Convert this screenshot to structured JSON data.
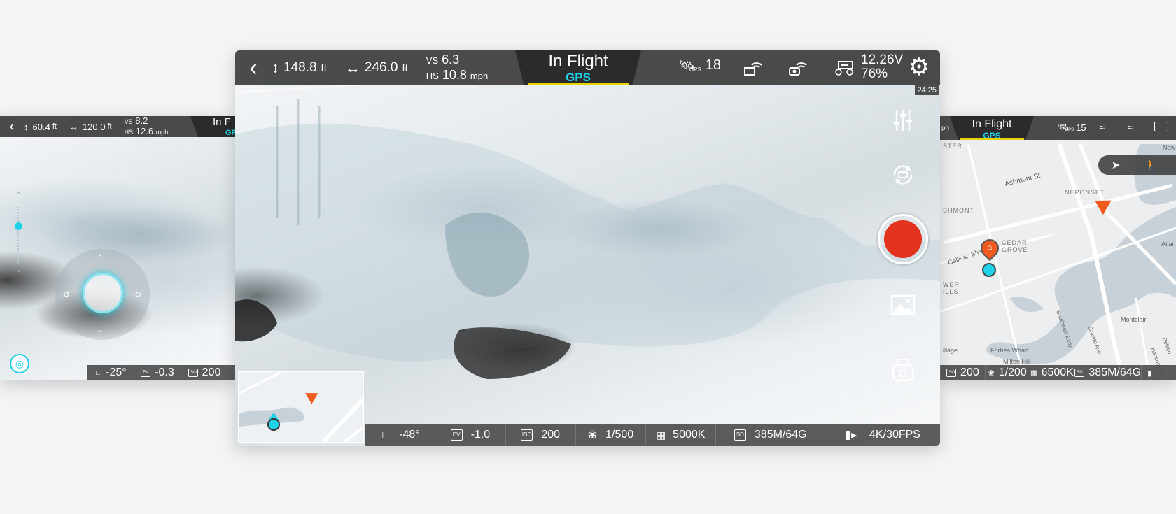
{
  "main": {
    "altitude": "148.8",
    "altitude_unit": "ft",
    "distance": "246.0",
    "distance_unit": "ft",
    "vs_label": "VS",
    "vs_value": "6.3",
    "hs_label": "HS",
    "hs_value": "10.8",
    "hs_unit": "mph",
    "flight_status": "In Flight",
    "flight_mode": "GPS",
    "gps_label": "GPS",
    "gps_count": "18",
    "battery_voltage": "12.26V",
    "battery_percent": "76%",
    "flight_time": "24:25",
    "bottom": {
      "gimbal": "-48°",
      "ev_label": "EV",
      "ev": "-1.0",
      "iso_label": "ISO",
      "iso": "200",
      "shutter": "1/500",
      "wb": "5000K",
      "sd_label": "SD",
      "storage": "385M/64G",
      "video": "4K/30FPS"
    }
  },
  "left": {
    "altitude": "60.4",
    "altitude_unit": "ft",
    "distance": "120.0",
    "distance_unit": "ft",
    "vs_label": "VS",
    "vs_value": "8.2",
    "hs_label": "HS",
    "hs_value": "12.6",
    "hs_unit": "mph",
    "flight_status": "In F",
    "flight_mode": "GP",
    "bottom": {
      "gimbal": "-25°",
      "ev_label": "EV",
      "ev": "-0.3",
      "iso_label": "ISO",
      "iso": "200"
    }
  },
  "right": {
    "hs_unit": "ph",
    "flight_status": "In Flight",
    "flight_mode": "GPS",
    "gps_label": "GPS",
    "gps_count": "15",
    "map_labels": {
      "ashmont_st": "Ashmont St",
      "neponset": "NEPONSET",
      "ashmont": "SHMONT",
      "cedar_grove": "CEDAR\nGROVE",
      "gallivan": "Gallivan Blvd",
      "lower_mills": "WER\nILLS",
      "ster": "STER",
      "montclair": "Montclair",
      "atlan": "Atlan",
      "forbes": "Forbes Wharf",
      "milton": "Milton Hill",
      "village": "illage",
      "southeast": "Southeast Expy",
      "granite": "Granite Ave",
      "hancock": "Hancock St",
      "new": "New",
      "bellmo": "Bellmo"
    },
    "bottom": {
      "iso_label": "ISO",
      "iso": "200",
      "shutter": "1/200",
      "wb": "6500K",
      "sd_label": "SD",
      "storage": "385M/64G"
    }
  },
  "colors": {
    "accent_cyan": "#1fd2e8",
    "record_red": "#e3321e",
    "drone_orange": "#f05a1e",
    "mode_yellow": "#e9d300"
  }
}
